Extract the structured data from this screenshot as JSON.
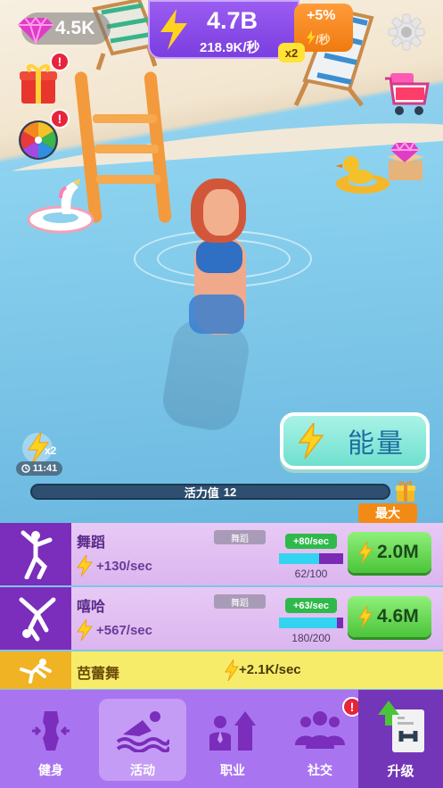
{
  "hud": {
    "gems": "4.5K",
    "energy_total": "4.7B",
    "energy_rate": "218.9K/秒",
    "bonus_percent": "+5%",
    "bonus_unit": "/秒",
    "multiplier": "x2"
  },
  "side_alerts": {
    "gift": "!",
    "wheel": "!"
  },
  "boost": {
    "multiplier": "x2",
    "timer": "11:41"
  },
  "energy_button": {
    "label": "能量"
  },
  "vitality": {
    "label": "活力值",
    "value": "12",
    "max_label": "最大"
  },
  "activities": [
    {
      "title": "舞蹈",
      "tag": "舞蹈",
      "rate": "+130/sec",
      "bonus": "+80/sec",
      "progress": "62/100",
      "progress_fraction": 0.62,
      "cost": "2.0M"
    },
    {
      "title": "嘻哈",
      "tag": "舞蹈",
      "rate": "+567/sec",
      "bonus": "+63/sec",
      "progress": "180/200",
      "progress_fraction": 0.9,
      "cost": "4.6M"
    },
    {
      "title": "芭蕾舞",
      "rate": "+2.1K/sec"
    }
  ],
  "nav": {
    "fitness": "健身",
    "activity": "活动",
    "career": "职业",
    "social": "社交",
    "upgrade": "升级",
    "social_alert": "!"
  },
  "colors": {
    "accent_purple": "#7b2dbb",
    "energy_yellow": "#ffd21f",
    "buy_green": "#4cc43a",
    "nav_purple": "#a974f0"
  }
}
